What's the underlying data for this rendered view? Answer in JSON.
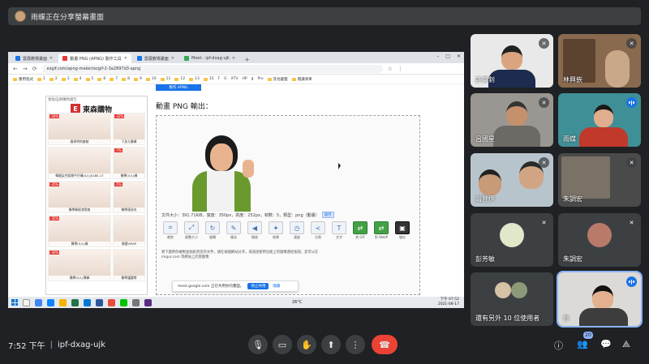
{
  "presenting_banner": {
    "text": "雨蝶正在分享螢幕畫面"
  },
  "shared_screen": {
    "tabs": [
      {
        "label": "雲展教場畫面"
      },
      {
        "label": "動畫 PNG (APNG) 製作工具"
      },
      {
        "label": "雲展教場畫面"
      },
      {
        "label": "Meet - ipf-dxag-ujk"
      }
    ],
    "window_controls": [
      "–",
      "□",
      "✕"
    ],
    "address": "ezgif.com/apng-maker/ezgif-2-3a2897d3-apng",
    "bookmarks": [
      "應用程式",
      "1",
      "2",
      "3",
      "4",
      "5",
      "6",
      "7",
      "8",
      "9",
      "10",
      "11",
      "12",
      "13",
      "15",
      "F",
      "G",
      "XTV",
      "HP",
      "g",
      "Pro",
      "其他書籤",
      "閱讀清單"
    ],
    "ad": {
      "top_label": "壹點伍網購物廣告",
      "brand_logo": "E",
      "brand_name": "東森購物",
      "products": [
        {
          "tag": "-34%",
          "caption": "春季時尚套裝"
        },
        {
          "tag": "-32%",
          "caption": "下身九釐褲"
        },
        {
          "tag": "",
          "caption": "韓國女性氣質牛仔褲(4入)$1BS-17"
        },
        {
          "tag": "-7%",
          "caption": "醫學(4入)褲"
        },
        {
          "tag": "-35%",
          "caption": "醫學褲經濟價格"
        },
        {
          "tag": "-5%",
          "caption": "醫學連身衣"
        },
        {
          "tag": "-35%",
          "caption": "醫學(5入)褲"
        },
        {
          "tag": "",
          "caption": "美國VIPAP"
        },
        {
          "tag": "-30%",
          "caption": "醫學(5入)彈褲"
        },
        {
          "tag": "",
          "caption": "醫學護腰帶"
        }
      ]
    },
    "section_button": "製作 APNG",
    "output_label": "動畫 PNG 輸出：",
    "file_info": "文件大小：391.71KiB，寬度：350px，高度：252px，幀數：5，類型：png（動畫）",
    "save_button": "儲存",
    "tools": [
      {
        "label": "裁剪",
        "icon": "crop-icon"
      },
      {
        "label": "調整大小",
        "icon": "resize-icon"
      },
      {
        "label": "旋轉",
        "icon": "rotate-icon"
      },
      {
        "label": "優化",
        "icon": "optimize-icon"
      },
      {
        "label": "撥放",
        "icon": "play-icon"
      },
      {
        "label": "效果",
        "icon": "effects-icon"
      },
      {
        "label": "速度",
        "icon": "speed-icon"
      },
      {
        "label": "分割",
        "icon": "split-icon"
      },
      {
        "label": "文字",
        "icon": "text-icon"
      },
      {
        "label": "到 GIF",
        "icon": "to-gif-icon"
      },
      {
        "label": "到 WebP",
        "icon": "to-webp-icon"
      },
      {
        "label": "儲存",
        "icon": "save-icon"
      }
    ],
    "note": "將下圖更改複製並粘貼到您的文件，請在兩個網站分享，或直接使用功能上的圖像連結按鈕，您可以在imgur.com 等網站上託管圖像",
    "infobar": {
      "text": "meet.google.com 正在共用你的畫面。",
      "stop": "停止共用",
      "hide": "隱藏"
    },
    "taskbar": {
      "temp": "26°C",
      "time": "下午 07:52",
      "date": "2021-08-17"
    }
  },
  "participants": [
    {
      "name": "許英釗",
      "muted": true,
      "speaking": false
    },
    {
      "name": "林興嶔",
      "muted": true,
      "speaking": false
    },
    {
      "name": "呂國星",
      "muted": true,
      "speaking": false
    },
    {
      "name": "雨蝶",
      "muted": false,
      "speaking": true
    },
    {
      "name": "翁甘伊",
      "muted": true,
      "speaking": false
    },
    {
      "name": "朱調宏",
      "muted": true,
      "speaking": false
    },
    {
      "name": "彭芳敏",
      "muted": true,
      "speaking": false
    },
    {
      "name": "朱調宏",
      "muted": true,
      "speaking": false
    },
    {
      "name": "還有另外 10 位使用者",
      "muted": false,
      "speaking": false
    },
    {
      "name": "你",
      "muted": false,
      "speaking": true
    }
  ],
  "meeting": {
    "time": "7:52 下午",
    "separator": "|",
    "code": "ipf-dxag-ujk"
  },
  "participant_count": "20",
  "colors": {
    "background": "#202124",
    "end_call": "#ea4335",
    "accent": "#1a73e8",
    "tile": "#3c4043"
  }
}
